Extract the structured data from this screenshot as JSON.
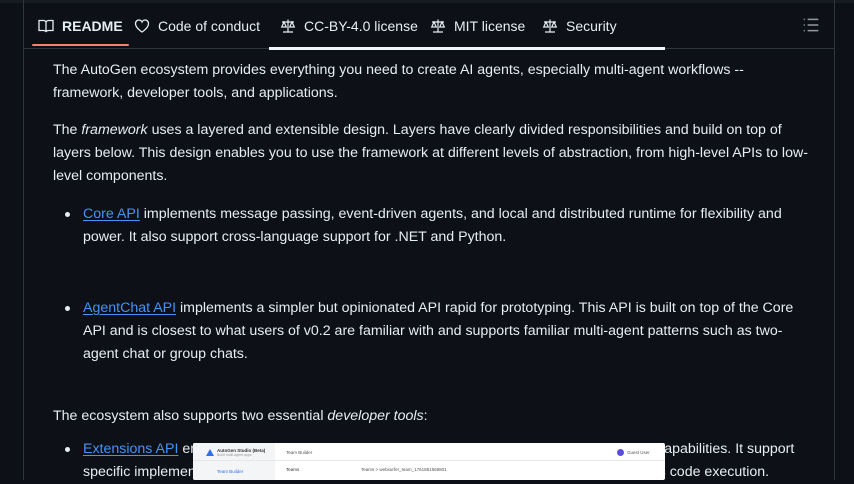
{
  "tabs": [
    {
      "label": "README",
      "icon": "book-icon",
      "active": true
    },
    {
      "label": "Code of conduct",
      "icon": "heart-icon",
      "active": false
    },
    {
      "label": "CC-BY-4.0 license",
      "icon": "scale-icon",
      "active": false
    },
    {
      "label": "MIT license",
      "icon": "scale-icon",
      "active": false
    },
    {
      "label": "Security",
      "icon": "scale-icon",
      "active": false
    }
  ],
  "menu_icon": "list-icon",
  "colors": {
    "background": "#0d1117",
    "text": "#e6edf3",
    "link": "#4493f8",
    "tab_underline": "#f78166",
    "border": "#30363d"
  },
  "content": {
    "p1": "The AutoGen ecosystem provides everything you need to create AI agents, especially multi-agent workflows -- framework, developer tools, and applications.",
    "p2_before": "The ",
    "p2_em": "framework",
    "p2_after": " uses a layered and extensible design. Layers have clearly divided responsibilities and build on top of layers below. This design enables you to use the framework at different levels of abstraction, from high-level APIs to low-level components.",
    "bullets": [
      {
        "link": "Core API",
        "text": " implements message passing, event-driven agents, and local and distributed runtime for flexibility and power. It also support cross-language support for .NET and Python."
      },
      {
        "link": "AgentChat API",
        "text": " implements a simpler but opinionated API rapid for prototyping. This API is built on top of the Core API and is closest to what users of v0.2 are familiar with and supports familiar multi-agent patterns such as two-agent chat or group chats."
      },
      {
        "link": "Extensions API",
        "text": " enables first- and third-party extensions continuously expanding framework capabilities. It support specific implementation of LLM clients (e.g., OpenAI, AzureOpenAI), and capabilities such as code execution."
      }
    ],
    "p3_before": "The ecosystem also supports two essential ",
    "p3_em": "developer tools",
    "p3_after": ":"
  },
  "preview": {
    "app_title": "AutoGen Studio (Beta)",
    "app_subtitle": "Build multi-agent apps",
    "header": "Team Builder",
    "sidebar_item": "Team Builder",
    "teams_label": "Teams",
    "breadcrumb": "Teams > websurfer_team_1761881569801",
    "user": "Guest User"
  }
}
